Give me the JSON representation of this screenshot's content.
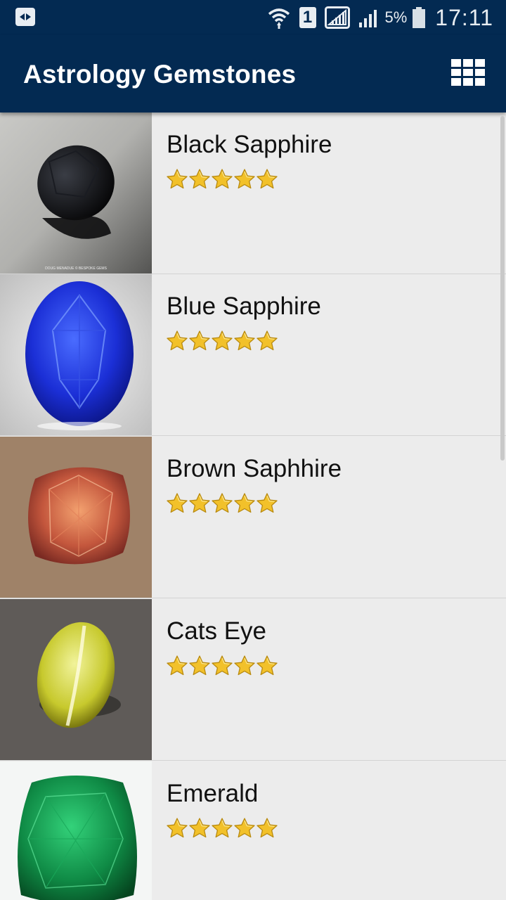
{
  "status_bar": {
    "battery_percent": "5%",
    "time": "17:11",
    "sim_slot": "1"
  },
  "app_bar": {
    "title": "Astrology Gemstones",
    "grid_icon": "grid-view-icon"
  },
  "gemstones": [
    {
      "name": "Black Sapphire",
      "rating": 5,
      "image": "black-sapphire-image",
      "watermark": "DOUG MENADUE © BESPOKE GEMS"
    },
    {
      "name": "Blue Sapphire",
      "rating": 5,
      "image": "blue-sapphire-image"
    },
    {
      "name": "Brown Saphhire",
      "rating": 5,
      "image": "brown-sapphire-image"
    },
    {
      "name": "Cats Eye",
      "rating": 5,
      "image": "cats-eye-image"
    },
    {
      "name": "Emerald",
      "rating": 5,
      "image": "emerald-image"
    }
  ],
  "colors": {
    "app_bar": "#032a52",
    "list_bg": "#ececec",
    "star": "#f2c12a"
  }
}
